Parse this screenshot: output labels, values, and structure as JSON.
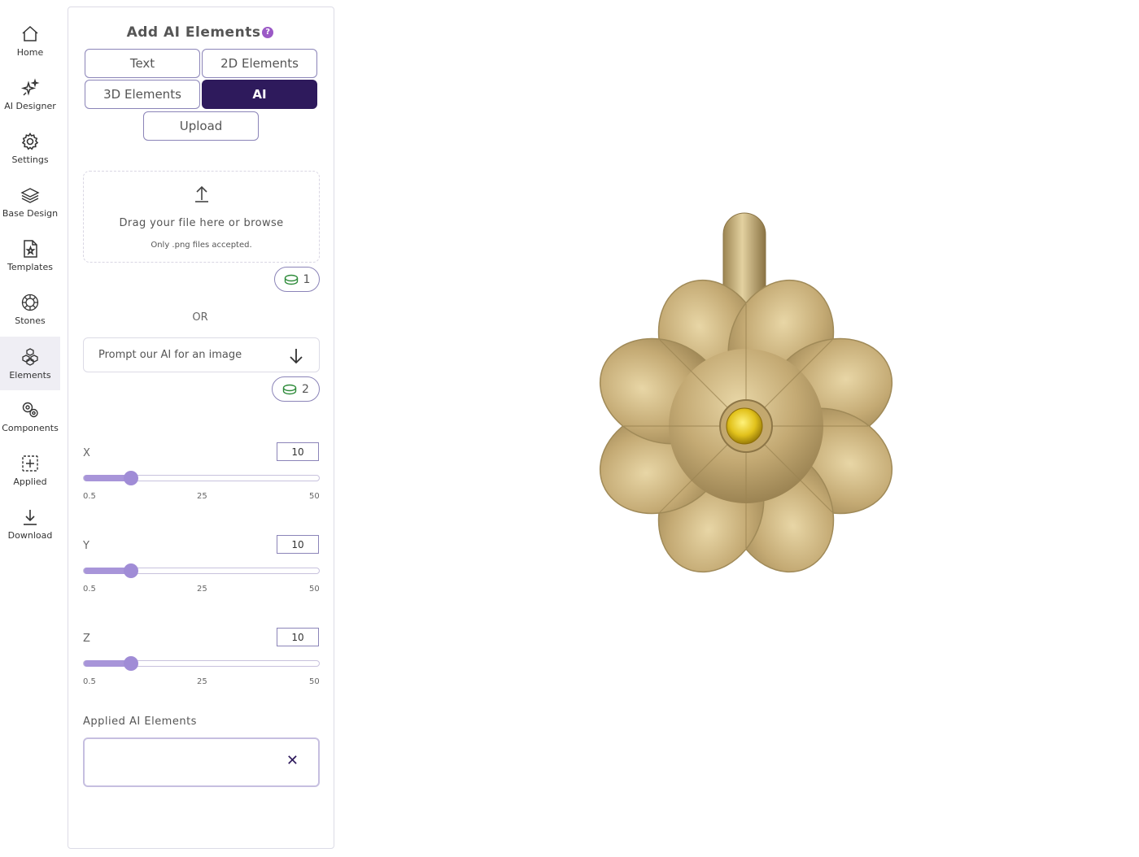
{
  "nav": {
    "items": [
      {
        "label": "Home",
        "icon": "home-icon"
      },
      {
        "label": "AI Designer",
        "icon": "sparkle-icon"
      },
      {
        "label": "Settings",
        "icon": "gear-icon"
      },
      {
        "label": "Base Design",
        "icon": "layers-icon"
      },
      {
        "label": "Templates",
        "icon": "template-icon"
      },
      {
        "label": "Stones",
        "icon": "gem-icon"
      },
      {
        "label": "Elements",
        "icon": "elements-icon"
      },
      {
        "label": "Components",
        "icon": "components-icon"
      },
      {
        "label": "Applied",
        "icon": "applied-icon"
      },
      {
        "label": "Download",
        "icon": "download-icon"
      }
    ],
    "active": "Elements"
  },
  "panel": {
    "title": "Add AI Elements",
    "help_icon": "?",
    "tabs": [
      "Text",
      "2D Elements",
      "3D Elements",
      "AI",
      "Upload"
    ],
    "active_tab": "AI",
    "dropzone": {
      "text": "Drag your file here or browse",
      "subtext": "Only .png files accepted."
    },
    "upload_cost": "1",
    "or_text": "OR",
    "prompt_placeholder": "Prompt our AI for an image",
    "prompt_cost": "2",
    "sliders": [
      {
        "label": "X",
        "value": "10",
        "min": "0.5",
        "mid": "25",
        "max": "50",
        "fraction": 0.2
      },
      {
        "label": "Y",
        "value": "10",
        "min": "0.5",
        "mid": "25",
        "max": "50",
        "fraction": 0.2
      },
      {
        "label": "Z",
        "value": "10",
        "min": "0.5",
        "mid": "25",
        "max": "50",
        "fraction": 0.2
      }
    ],
    "applied_label": "Applied AI Elements",
    "remove_symbol": "✕"
  },
  "colors": {
    "accent": "#2e1a5c",
    "slider": "#a08cd6",
    "gold": "#c9b07a",
    "stone": "#e8c620"
  }
}
